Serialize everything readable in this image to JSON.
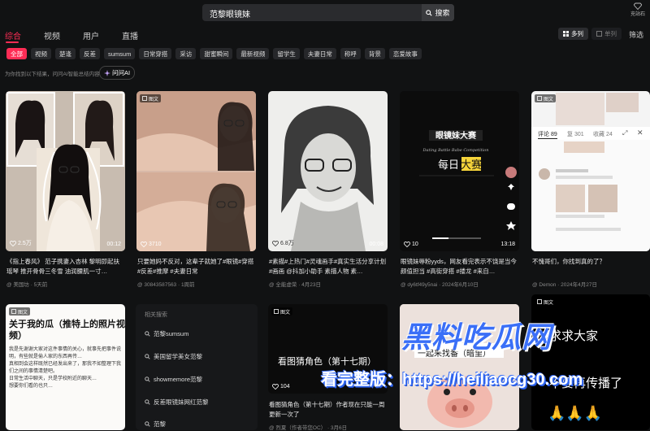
{
  "search": {
    "query": "范黎眼镜妹",
    "button": "搜索"
  },
  "header": {
    "charge_label": "充站石"
  },
  "tabs": [
    {
      "label": "综合"
    },
    {
      "label": "视频"
    },
    {
      "label": "用户"
    },
    {
      "label": "直播"
    }
  ],
  "view": {
    "multi": "多列",
    "single": "单列",
    "filter": "筛选"
  },
  "chips": [
    "全部",
    "视频",
    "楚逢",
    "反差",
    "sumsum",
    "日常穿搭",
    "采访",
    "甜蜜瞬间",
    "最新视频",
    "留学生",
    "夫妻日常",
    "称呼",
    "背景",
    "恋爱故事"
  ],
  "notice": "为你找到以下结果，问问AI智能总结内容",
  "ask_ai": "问问AI",
  "cards": [
    {
      "badge": "",
      "likes": "2.5万",
      "duration": "00:12",
      "title": "《指上春风》 范子携妻入杏林 黎明即起扶瑶琴 推开骨骨三冬雪 油润腰肌一寸…",
      "meta": "@ 美国坊 · 5天前"
    },
    {
      "badge": "图文",
      "likes": "3710",
      "duration": "",
      "title": "只要她妈不反对，这辈子就她了#眼镜#穿搭#反差#推摩 #夫妻日常",
      "meta": "@ 30843587563 · 1周前"
    },
    {
      "badge": "",
      "likes": "6.8万",
      "duration": "00:08",
      "title": "#素描#上热门#灵魂画手#真实生活分享计划#画画 @抖加小助手 素描人物 素…",
      "meta": "@ 全能虚荣 · 4月23日"
    },
    {
      "badge": "",
      "likes": "10",
      "duration": "13:18",
      "title": "眼镜妹辱粉yyds，网友看完表示不饶是当今颜值担当 #高街穿搭 #搂龙 #来自…",
      "meta": "@ dy6tf49y5nai · 2024年6月10日"
    },
    {
      "badge": "图文",
      "likes": "",
      "duration": "",
      "title": "不愧哥们，你找到真的了？",
      "meta": "@ Demon · 2024年4月27日"
    },
    {
      "badge": "图文",
      "title": "关于我的瓜（推特上的照片视频）",
      "meta": ""
    },
    {
      "badge": "图文",
      "likes": "104",
      "title": "看图猜角色（第十七期）作者现在只能一周更新一次了",
      "meta": "@ 烈夏（作者带您OC） · 3月6日"
    },
    {
      "badge": "",
      "title": "一起来找番（暗里）",
      "meta": ""
    },
    {
      "badge": "图文",
      "title": "求求大家 不要再传播了",
      "meta": ""
    }
  ],
  "card6_text": "看图猜角色（第十七期）",
  "card8_text": "一起来找番（暗里）",
  "card9_line1": "求求大家",
  "card9_line2": "不要再传播了",
  "card5_lines": [
    "关于我的瓜（推特上的照片视",
    "频）",
    "我是先谢谢大家对这件事情的关心，就事先把事件说明，有些就是偷人家的东西再传…",
    "真相到会这样既然已经发出来了，那我不如整理下我们之间的事情清楚吧。",
    "日常生活中聊天，只是学校附近的聊天…",
    "想要你们看的也只…"
  ],
  "related": {
    "heading": "相关搜索",
    "items": [
      "范黎sumsum",
      "美国留学美女范黎",
      "showmemore范黎",
      "反差眼镜妹网红范黎",
      "范黎"
    ]
  },
  "popup": {
    "comments": "评论 89",
    "shares": "复 301",
    "favorites": "收藏 24"
  },
  "watermark": {
    "line1": "黑料吃瓜网",
    "line2": "看完整版：https://heiliaocg30.com",
    "line3": "heiliaocg30.com"
  }
}
